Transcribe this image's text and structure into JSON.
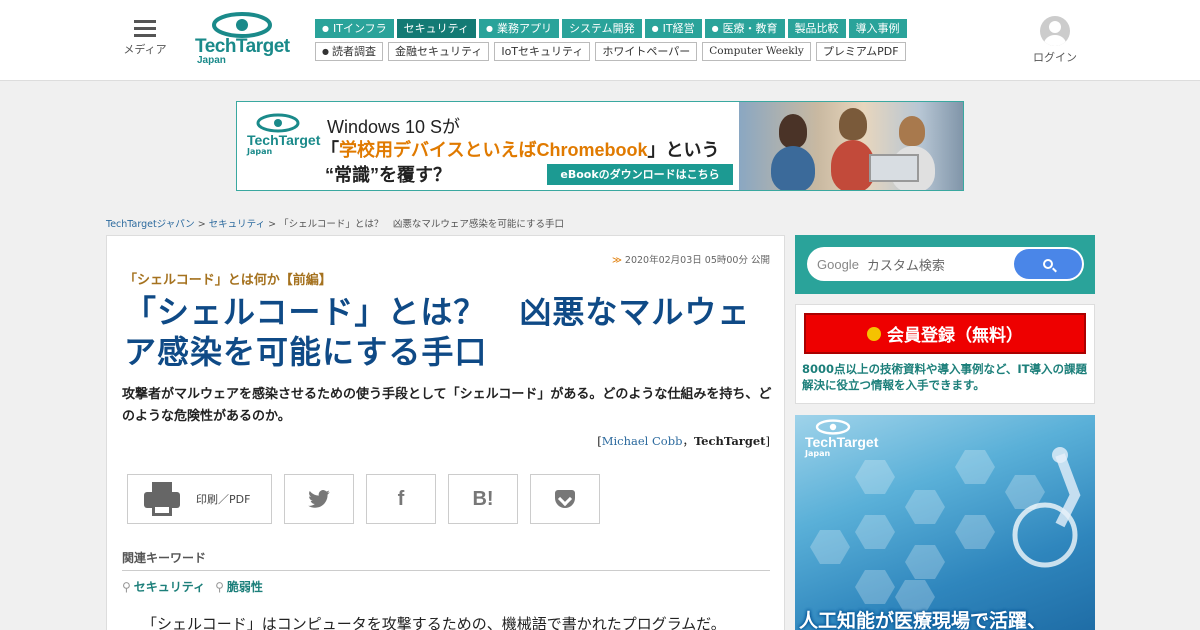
{
  "header": {
    "menu_label": "メディア",
    "logo": {
      "name": "TechTarget",
      "sub": "Japan"
    },
    "nav_primary": [
      {
        "label": "ITインフラ",
        "dot": true,
        "active": false
      },
      {
        "label": "セキュリティ",
        "dot": false,
        "active": true
      },
      {
        "label": "業務アプリ",
        "dot": true,
        "active": false
      },
      {
        "label": "システム開発",
        "dot": false,
        "active": false
      },
      {
        "label": "IT経営",
        "dot": true,
        "active": false
      },
      {
        "label": "医療・教育",
        "dot": true,
        "active": false
      },
      {
        "label": "製品比較",
        "dot": false,
        "active": false
      },
      {
        "label": "導入事例",
        "dot": false,
        "active": false
      }
    ],
    "nav_secondary": [
      {
        "label": "読者調査",
        "dot": true
      },
      {
        "label": "金融セキュリティ",
        "dot": false
      },
      {
        "label": "IoTセキュリティ",
        "dot": false
      },
      {
        "label": "ホワイトペーパー",
        "dot": false
      },
      {
        "label": "Computer Weekly",
        "dot": false
      },
      {
        "label": "プレミアムPDF",
        "dot": false
      }
    ],
    "login_label": "ログイン"
  },
  "banner": {
    "logo": "TechTarget",
    "logo_sub": "Japan",
    "line1": "Windows 10 Sが",
    "line2_open": "「",
    "line2_highlight": "学校用デバイスといえばChromebook",
    "line2_close": "」という",
    "line3": "“常識”を覆す？",
    "cta": "eBookのダウンロードはこちら"
  },
  "breadcrumb": {
    "items": [
      "TechTargetジャパン",
      "セキュリティ",
      "「シェルコード」とは？　凶悪なマルウェア感染を可能にする手口"
    ],
    "separator": " > "
  },
  "article": {
    "published": "2020年02月03日 05時00分 公開",
    "kicker": "「シェルコード」とは何か【前編】",
    "title": "「シェルコード」とは？　凶悪なマルウェア感染を可能にする手口",
    "lead": "攻撃者がマルウェアを感染させるための使う手段として「シェルコード」がある。どのような仕組みを持ち、どのような危険性があるのか。",
    "byline_open": "[",
    "author": "Michael Cobb",
    "byline_sep": "，",
    "publication": "TechTarget",
    "byline_close": "]",
    "share": {
      "print_label": "印刷／PDF",
      "twitter_glyph": "🐦",
      "facebook_glyph": "f",
      "hatena_glyph": "B!"
    },
    "keywords_label": "関連キーワード",
    "keywords": [
      "セキュリティ",
      "脆弱性"
    ],
    "body_first_line": "「シェルコード」はコンピュータを攻撃するための、機械語で書かれたプログラムだ。"
  },
  "sidebar": {
    "search": {
      "brand": "Google",
      "placeholder": "カスタム検索"
    },
    "register": {
      "button_label": "会員登録（無料）",
      "description": "8000点以上の技術資料や導入事例など、IT導入の課題解決に役立つ情報を入手できます。"
    },
    "ad": {
      "logo": "TechTarget",
      "logo_sub": "Japan",
      "headline": "人工知能が医療現場で活躍、"
    }
  }
}
